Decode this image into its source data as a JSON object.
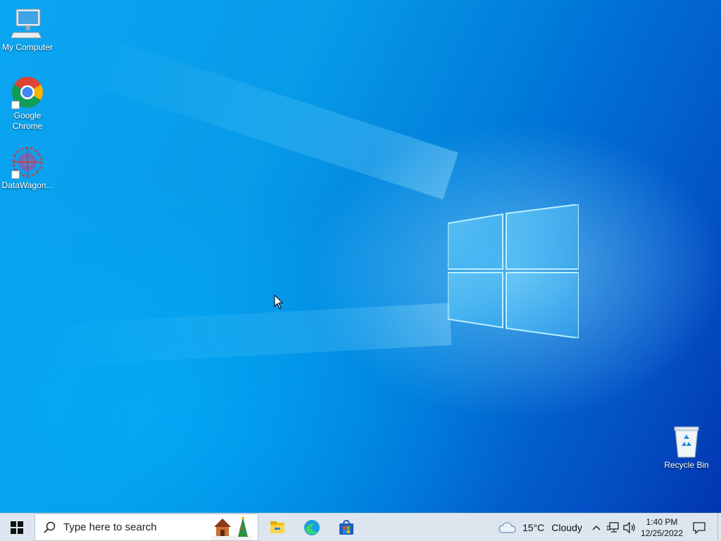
{
  "desktop": {
    "icons": [
      {
        "label": "My Computer",
        "icon": "computer-icon"
      },
      {
        "label": "Google Chrome",
        "icon": "chrome-icon"
      },
      {
        "label": "DataWagon...",
        "icon": "datawagon-icon"
      },
      {
        "label": "Recycle Bin",
        "icon": "recycle-bin-icon"
      }
    ]
  },
  "taskbar": {
    "search_placeholder": "Type here to search",
    "pinned_apps": [
      {
        "name": "File Explorer",
        "icon": "file-explorer-icon"
      },
      {
        "name": "Microsoft Edge",
        "icon": "edge-icon"
      },
      {
        "name": "Microsoft Store",
        "icon": "store-icon"
      }
    ],
    "weather": {
      "temperature": "15°C",
      "condition": "Cloudy",
      "icon": "cloud-icon"
    },
    "clock": {
      "time": "1:40 PM",
      "date": "12/25/2022"
    }
  },
  "colors": {
    "wallpaper_light": "#0aa6f2",
    "wallpaper_dark": "#0236b0",
    "taskbar_bg": "#dde6ee",
    "windows_logo": "#9ee6ff"
  }
}
